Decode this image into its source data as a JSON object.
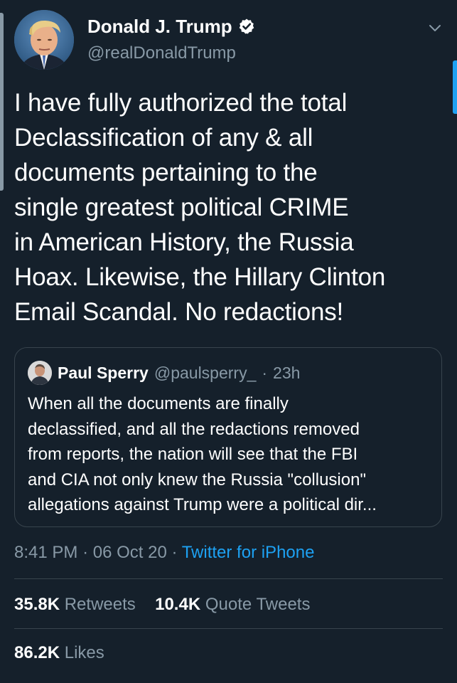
{
  "tweet": {
    "author": {
      "name": "Donald J. Trump",
      "handle": "@realDonaldTrump",
      "verified": true
    },
    "text": "I have fully authorized the total\nDeclassification of any & all\ndocuments pertaining to the\nsingle greatest political CRIME\nin American History, the Russia\nHoax. Likewise, the Hillary Clinton\nEmail Scandal. No redactions!",
    "time": "8:41 PM",
    "date": "06 Oct 20",
    "source": "Twitter for iPhone",
    "separator": "·"
  },
  "quoted_tweet": {
    "name": "Paul Sperry",
    "handle": "@paulsperry_",
    "age": "23h",
    "separator": "·",
    "text": "When all the documents are finally\ndeclassified, and all the redactions removed\nfrom reports, the nation will see that the FBI\nand CIA not only knew the Russia \"collusion\"\nallegations against Trump were a political dir..."
  },
  "stats": {
    "retweets_count": "35.8K",
    "retweets_label": "Retweets",
    "quote_tweets_count": "10.4K",
    "quote_tweets_label": "Quote Tweets",
    "likes_count": "86.2K",
    "likes_label": "Likes"
  },
  "icons": {
    "verified": "verified-badge-icon",
    "more": "chevron-down-icon"
  },
  "colors": {
    "background": "#15202b",
    "text": "#ffffff",
    "secondary": "#8899a6",
    "accent": "#1da1f2",
    "border": "#38444d"
  }
}
